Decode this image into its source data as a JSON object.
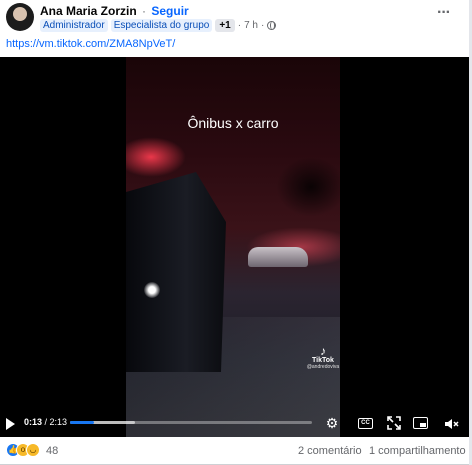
{
  "post": {
    "author": "Ana Maria Zorzin",
    "separator": "·",
    "follow_label": "Seguir",
    "badges": [
      "Administrador",
      "Especialista do grupo",
      "+1"
    ],
    "time": "7 h",
    "time_separator": "·",
    "more_icon": "more-horizontal-icon",
    "link_text": "https://vm.tiktok.com/ZMA8NpVeT/"
  },
  "video": {
    "caption": "Ônibus x carro",
    "watermark_brand": "TikTok",
    "watermark_handle": "@andredoviva",
    "current_time": "0:13",
    "duration": "2:13",
    "time_divider": " / ",
    "progress_fraction": 0.098,
    "buffer_fraction": 0.27,
    "cc_label": "CC",
    "icons": {
      "play": "play-icon",
      "settings": "gear-icon",
      "captions": "cc-icon",
      "expand": "expand-icon",
      "pip": "picture-in-picture-icon",
      "volume": "volume-muted-icon"
    }
  },
  "footer": {
    "reaction_count": "48",
    "comments": "2 comentário",
    "shares": "1 compartilhamento",
    "reactions": [
      "like-icon",
      "wow-icon",
      "sad-icon"
    ]
  },
  "colors": {
    "link": "#0866ff",
    "progress": "#1877f2",
    "badge_bg": "#e7f0fd"
  }
}
